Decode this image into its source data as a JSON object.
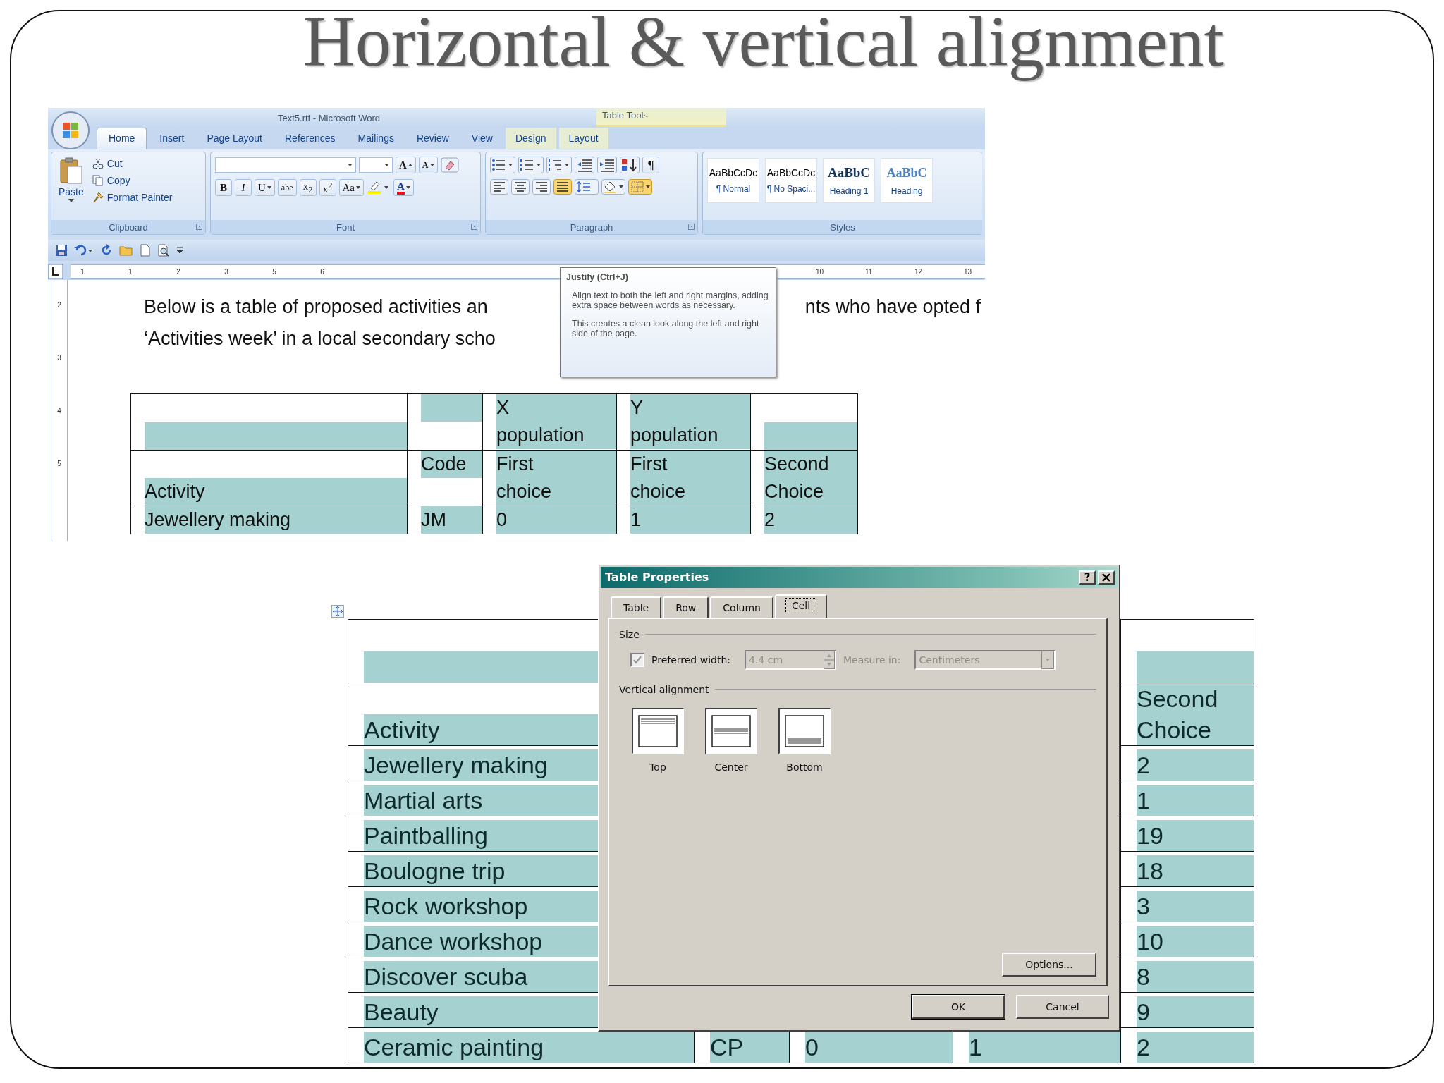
{
  "slide": {
    "title": "Horizontal & vertical alignment"
  },
  "word": {
    "window_title": "Text5.rtf - Microsoft Word",
    "contextual_title": "Table Tools",
    "tabs": [
      {
        "label": "Home",
        "selected": true,
        "contextual": false
      },
      {
        "label": "Insert",
        "selected": false,
        "contextual": false
      },
      {
        "label": "Page Layout",
        "selected": false,
        "contextual": false
      },
      {
        "label": "References",
        "selected": false,
        "contextual": false
      },
      {
        "label": "Mailings",
        "selected": false,
        "contextual": false
      },
      {
        "label": "Review",
        "selected": false,
        "contextual": false
      },
      {
        "label": "View",
        "selected": false,
        "contextual": false
      },
      {
        "label": "Design",
        "selected": false,
        "contextual": true
      },
      {
        "label": "Layout",
        "selected": false,
        "contextual": true
      }
    ],
    "clipboard": {
      "paste": "Paste",
      "group_label": "Clipboard",
      "commands": [
        {
          "kind": "cut",
          "label": "Cut"
        },
        {
          "kind": "copy",
          "label": "Copy"
        },
        {
          "kind": "format-painter",
          "label": "Format Painter"
        }
      ]
    },
    "font": {
      "group_label": "Font",
      "grow": "A",
      "shrink": "A",
      "color_label": "A",
      "format_buttons": [
        {
          "kind": "bold",
          "label": "B"
        },
        {
          "kind": "italic",
          "label": "I"
        },
        {
          "kind": "underline",
          "label": "U"
        },
        {
          "kind": "strike",
          "label": "abe"
        },
        {
          "kind": "subscript",
          "label": "x$_{2}$"
        },
        {
          "kind": "superscript",
          "label": "x$^{2}$"
        },
        {
          "kind": "case",
          "label": "Aa"
        }
      ]
    },
    "paragraph": {
      "group_label": "Paragraph",
      "row1": [
        {
          "kind": "bullets"
        },
        {
          "kind": "numbering"
        },
        {
          "kind": "multilevel"
        },
        {
          "kind": "decrease-indent"
        },
        {
          "kind": "increase-indent"
        },
        {
          "kind": "sort"
        },
        {
          "kind": "pilcrow",
          "label": "¶"
        }
      ],
      "row2": [
        {
          "kind": "align-left",
          "highlighted": false
        },
        {
          "kind": "align-center",
          "highlighted": false
        },
        {
          "kind": "align-right",
          "highlighted": false
        },
        {
          "kind": "justify",
          "highlighted": true
        },
        {
          "kind": "line-spacing",
          "highlighted": false
        },
        {
          "kind": "shading",
          "highlighted": false
        },
        {
          "kind": "borders",
          "highlighted": true
        }
      ]
    },
    "styles": {
      "group_label": "Styles",
      "items": [
        {
          "kind": "body",
          "preview": "AaBbCcDc",
          "name": "¶ Normal"
        },
        {
          "kind": "body",
          "preview": "AaBbCcDc",
          "name": "¶ No Spaci..."
        },
        {
          "kind": "heading1",
          "preview": "AaBbC",
          "name": "Heading 1"
        },
        {
          "kind": "heading2",
          "preview": "AaBbC",
          "name": "Heading"
        }
      ]
    },
    "ruler": {
      "left_numbers": [
        "1",
        "1",
        "2",
        "3",
        "5",
        "6"
      ],
      "right_numbers": [
        "10",
        "11",
        "12",
        "13"
      ],
      "vertical_numbers": [
        "2",
        "3",
        "4",
        "5"
      ]
    },
    "document": {
      "lines": [
        {
          "left": "Below is a table of proposed activities an",
          "right": "nts who have opted f"
        },
        {
          "left": "‘Activities week’ in a local secondary scho"
        }
      ]
    },
    "tooltip": {
      "title": "Justify (Ctrl+J)",
      "paragraphs": [
        "Align text to both the left and right margins, adding extra space between words as necessary.",
        "This creates a clean look along the left and right side of the page."
      ]
    },
    "table": {
      "rows": [
        {
          "cells": [
            {
              "kind": "bottom"
            },
            {
              "kind": "top"
            },
            {
              "text": "X\npopulation",
              "kind": "top"
            },
            {
              "text": "Y\npopulation",
              "kind": "top"
            },
            {
              "kind": "bottom"
            }
          ]
        },
        {
          "cells": [
            {
              "text": "Activity",
              "kind": "bottom"
            },
            {
              "text": "Code",
              "kind": "top"
            },
            {
              "text": "First\nchoice",
              "kind": "top"
            },
            {
              "text": "First\nchoice",
              "kind": "top"
            },
            {
              "text": "Second\nChoice",
              "kind": "top"
            }
          ]
        },
        {
          "cells": [
            {
              "text": "Jewellery making",
              "kind": "top"
            },
            {
              "text": "JM",
              "kind": "top"
            },
            {
              "text": "0",
              "kind": "top"
            },
            {
              "text": "1",
              "kind": "top"
            },
            {
              "text": "2",
              "kind": "top"
            }
          ]
        }
      ]
    }
  },
  "word2": {
    "table": {
      "rows": [
        {
          "cells": [
            {
              "kind": "bottom"
            },
            {},
            {},
            {},
            {
              "kind": "bottom"
            }
          ]
        },
        {
          "cells": [
            {
              "text": "Activity",
              "kind": "bottom"
            },
            {},
            {},
            {},
            {
              "text": "Second\nChoice",
              "kind": "bottom"
            }
          ]
        },
        {
          "cells": [
            {
              "text": "Jewellery making",
              "kind": "bottom"
            },
            {},
            {},
            {},
            {
              "text": "2",
              "kind": "bottom"
            }
          ]
        },
        {
          "cells": [
            {
              "text": "Martial arts",
              "kind": "bottom"
            },
            {},
            {},
            {},
            {
              "text": "1",
              "kind": "bottom"
            }
          ]
        },
        {
          "cells": [
            {
              "text": "Paintballing",
              "kind": "bottom"
            },
            {},
            {},
            {},
            {
              "text": "19",
              "kind": "bottom"
            }
          ]
        },
        {
          "cells": [
            {
              "text": "Boulogne trip",
              "kind": "bottom"
            },
            {},
            {},
            {},
            {
              "text": "18",
              "kind": "bottom"
            }
          ]
        },
        {
          "cells": [
            {
              "text": "Rock workshop",
              "kind": "bottom"
            },
            {},
            {},
            {},
            {
              "text": "3",
              "kind": "bottom"
            }
          ]
        },
        {
          "cells": [
            {
              "text": "Dance workshop",
              "kind": "bottom"
            },
            {},
            {},
            {},
            {
              "text": "10",
              "kind": "bottom"
            }
          ]
        },
        {
          "cells": [
            {
              "text": "Discover scuba",
              "kind": "bottom"
            },
            {},
            {},
            {},
            {
              "text": "8",
              "kind": "bottom"
            }
          ]
        },
        {
          "cells": [
            {
              "text": "Beauty",
              "kind": "bottom"
            },
            {},
            {},
            {},
            {
              "text": "9",
              "kind": "bottom"
            }
          ]
        },
        {
          "cells": [
            {
              "text": "Ceramic painting",
              "kind": "bottom"
            },
            {
              "text": "CP",
              "kind": "bottom"
            },
            {
              "text": "0",
              "kind": "bottom"
            },
            {
              "text": "1",
              "kind": "bottom"
            },
            {
              "text": "2",
              "kind": "bottom"
            }
          ]
        }
      ]
    },
    "dialog": {
      "title": "Table Properties",
      "help": "?",
      "tabs": [
        {
          "label": "Table",
          "selected": false
        },
        {
          "label": "Row",
          "selected": false
        },
        {
          "label": "Column",
          "selected": false
        },
        {
          "label": "Cell",
          "selected": true
        }
      ],
      "size_label": "Size",
      "preferred_width": {
        "label": "Preferred width:",
        "checked": true,
        "value": "4.4 cm",
        "disabled": true
      },
      "measure_in": {
        "label": "Measure in:",
        "value": "Centimeters",
        "disabled": true
      },
      "vertical_alignment": {
        "label": "Vertical alignment",
        "options": [
          {
            "kind": "top",
            "label": "Top"
          },
          {
            "kind": "center",
            "label": "Center"
          },
          {
            "kind": "bottom",
            "label": "Bottom"
          }
        ]
      },
      "options_button": "Options...",
      "buttons": [
        "OK",
        "Cancel"
      ]
    }
  }
}
